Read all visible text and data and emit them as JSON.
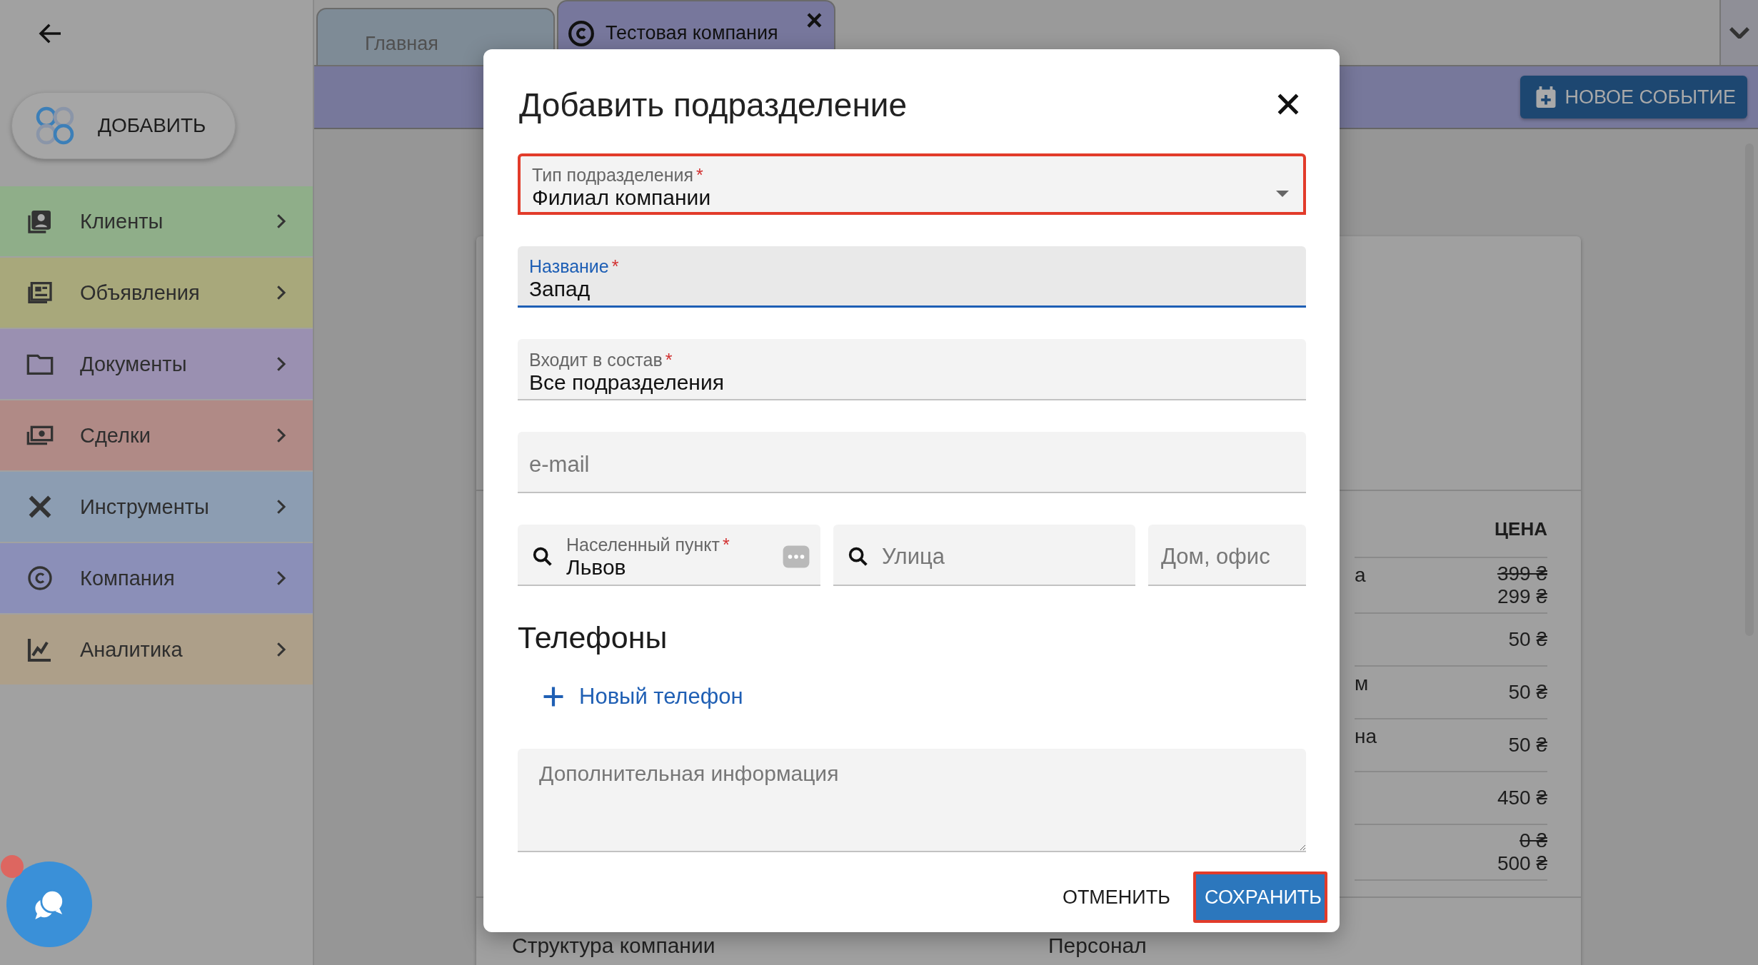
{
  "add_button": {
    "label": "ДОБАВИТЬ"
  },
  "sidebar": {
    "items": [
      {
        "label": "Клиенты",
        "color": "#8fae89"
      },
      {
        "label": "Объявления",
        "color": "#a8a87b"
      },
      {
        "label": "Документы",
        "color": "#9a90b1"
      },
      {
        "label": "Сделки",
        "color": "#b08a86"
      },
      {
        "label": "Инструменты",
        "color": "#8c9db2"
      },
      {
        "label": "Компания",
        "color": "#8b8fb8"
      },
      {
        "label": "Аналитика",
        "color": "#ad9f89"
      }
    ]
  },
  "tabs": [
    {
      "label": "Главная",
      "selected": false,
      "closable": false
    },
    {
      "label": "Тестовая компания",
      "selected": true,
      "closable": true
    }
  ],
  "tab_close": "×",
  "toolbar": {
    "new_event_button": "НОВОЕ СОБЫТИЕ"
  },
  "price_table": {
    "header": "ЦЕНА",
    "rows": [
      {
        "name": "а",
        "old_price": "399 ₴",
        "price": "299 ₴"
      },
      {
        "price": "50 ₴"
      },
      {
        "name": "м",
        "price": "50 ₴"
      },
      {
        "name": "на",
        "price": "50 ₴"
      },
      {
        "price": "450 ₴"
      },
      {
        "old_price": "0 ₴",
        "price": "500 ₴"
      }
    ]
  },
  "sections": [
    "Структура компании",
    "Персонал"
  ],
  "chat": {
    "unread": true
  },
  "dialog": {
    "title": "Добавить подразделение",
    "required_mark": "*",
    "fields": [
      {
        "kind": "select",
        "label": "Тип подразделения",
        "value": "Филиал компании",
        "required": true,
        "focused": false,
        "highlighted": true
      },
      {
        "kind": "text",
        "label": "Название",
        "value": "Запад",
        "required": true,
        "focused": true,
        "highlighted": false
      },
      {
        "kind": "text",
        "label": "Входит в состав",
        "value": "Все подразделения",
        "required": true,
        "focused": false,
        "highlighted": false
      },
      {
        "kind": "text",
        "placeholder": "e-mail",
        "required": false,
        "focused": false,
        "highlighted": false
      }
    ],
    "address_fields": [
      {
        "label": "Населенный пункт",
        "value": "Львов",
        "required": true,
        "search": true,
        "autofill_badge": true
      },
      {
        "placeholder": "Улица",
        "required": false,
        "search": true,
        "autofill_badge": false
      },
      {
        "placeholder": "Дом, офис",
        "required": false,
        "search": false,
        "autofill_badge": false
      }
    ],
    "phones": {
      "title": "Телефоны",
      "add_label": "Новый телефон"
    },
    "notes": {
      "placeholder": "Дополнительная информация"
    },
    "buttons": [
      {
        "label": "ОТМЕНИТЬ",
        "kind": "text",
        "highlighted": false
      },
      {
        "label": "СОХРАНИТЬ",
        "kind": "primary",
        "highlighted": true
      }
    ]
  }
}
